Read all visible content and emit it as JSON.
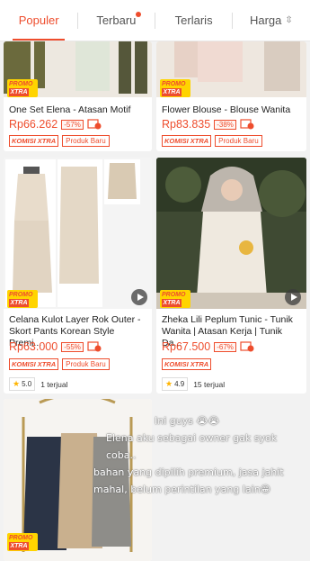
{
  "tabs": [
    {
      "label": "Populer"
    },
    {
      "label": "Terbaru"
    },
    {
      "label": "Terlaris"
    },
    {
      "label": "Harga"
    }
  ],
  "promo_badge": {
    "line1": "PROMO",
    "line2": "XTRA"
  },
  "products": [
    {
      "title": "One Set Elena - Atasan Motif",
      "price": "Rp66.262",
      "discount": "-57%",
      "badges": [
        "KOMISI XTRA",
        "Produk Baru"
      ]
    },
    {
      "title": "Flower Blouse - Blouse Wanita",
      "price": "Rp83.835",
      "discount": "-38%",
      "badges": [
        "KOMISI XTRA",
        "Produk Baru"
      ]
    },
    {
      "title": "Celana Kulot Layer Rok Outer - Skort Pants Korean Style Premi...",
      "price": "Rp63.000",
      "discount": "-55%",
      "badges": [
        "KOMISI XTRA",
        "Produk Baru"
      ],
      "rating": "5.0",
      "sold": "1 terjual"
    },
    {
      "title": "Zheka Lili Peplum Tunic - Tunik Wanita | Atasan Kerja | Tunik Da...",
      "price": "Rp67.500",
      "discount": "-67%",
      "badges": [
        "KOMISI XTRA"
      ],
      "rating": "4.9",
      "sold": "15 terjual"
    }
  ],
  "overlay_text": [
    "Ini guys 😭😭",
    "Elena aku sebagai owner gak syok coba..",
    "bahan yang dipilih premium, jasa jahit mahal, belum perintilan yang lain😁"
  ],
  "colors": {
    "accent": "#ee4d2d",
    "promo_yellow": "#ffd400"
  }
}
